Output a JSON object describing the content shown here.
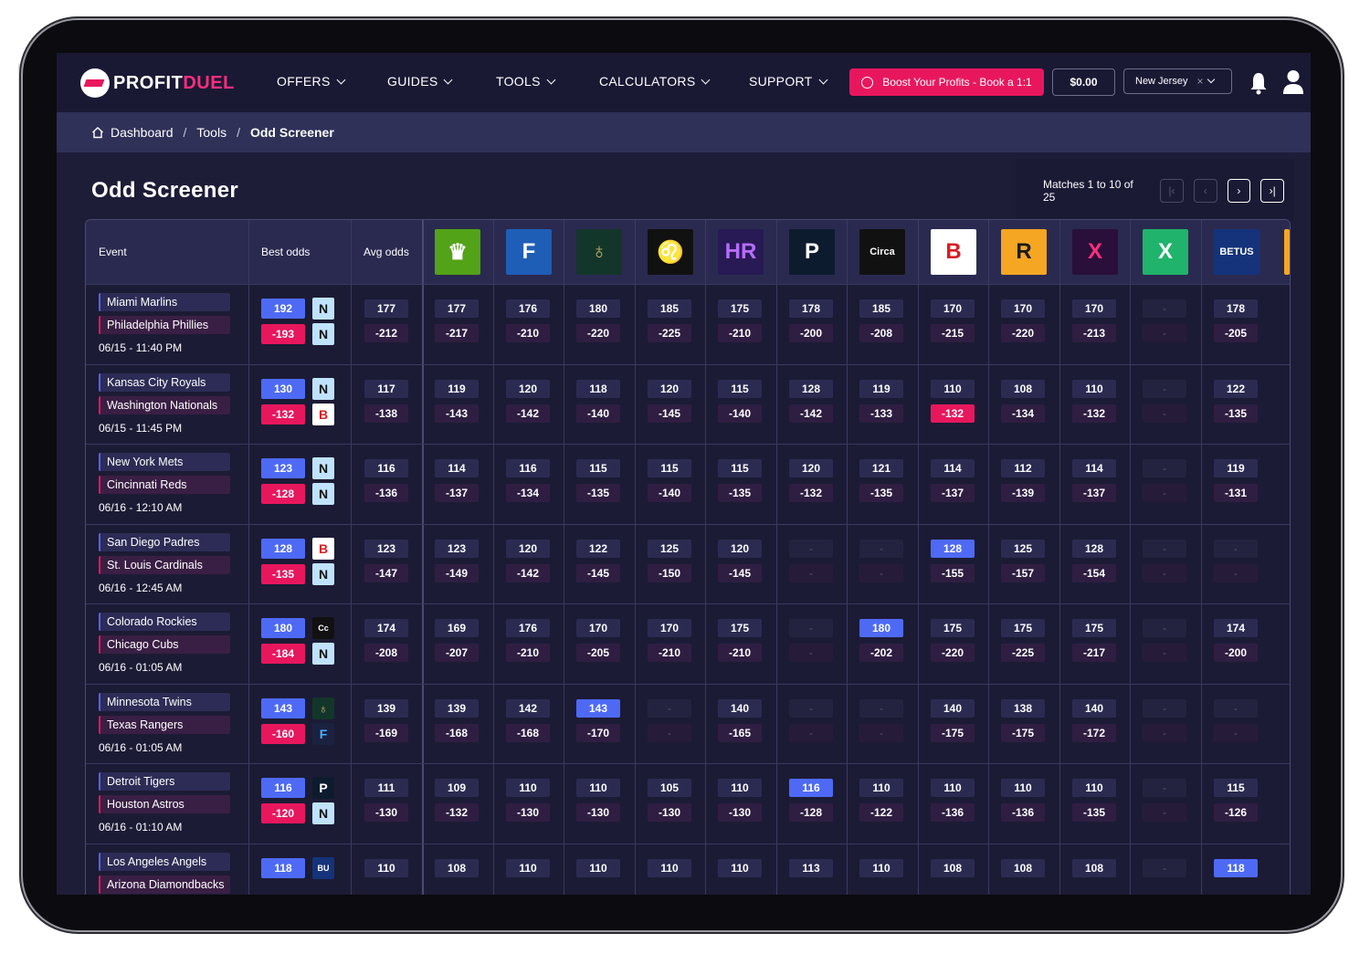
{
  "brand": {
    "part1": "PROFIT",
    "part2": "DUEL"
  },
  "nav": [
    {
      "label": "OFFERS",
      "name": "nav-offers"
    },
    {
      "label": "GUIDES",
      "name": "nav-guides"
    },
    {
      "label": "TOOLS",
      "name": "nav-tools"
    },
    {
      "label": "CALCULATORS",
      "name": "nav-calculators"
    },
    {
      "label": "SUPPORT",
      "name": "nav-support"
    }
  ],
  "header": {
    "boost_label": "Boost Your Profits - Book a 1:1",
    "balance": "$0.00",
    "state": "New Jersey",
    "state_clear": "×"
  },
  "breadcrumb": {
    "items": [
      "Dashboard",
      "Tools"
    ],
    "separator": "/",
    "current": "Odd Screener"
  },
  "page": {
    "title": "Odd Screener"
  },
  "pagination": {
    "text": "Matches 1 to 10 of 25",
    "first": "|‹",
    "prev": "‹",
    "next": "›",
    "last": "›|"
  },
  "table": {
    "col_event": "Event",
    "col_best": "Best odds",
    "col_avg": "Avg odds"
  },
  "books": [
    {
      "id": "draftkings",
      "bg": "#53a318",
      "glyph": "♛",
      "color": "#ffffff"
    },
    {
      "id": "fanduel",
      "bg": "#1f5eb7",
      "glyph": "F",
      "color": "#ffffff"
    },
    {
      "id": "goldennugget",
      "bg": "#13362a",
      "glyph": "♁",
      "color": "#c9b36a"
    },
    {
      "id": "betmgm",
      "bg": "#111111",
      "glyph": "♌",
      "color": "#c8a253"
    },
    {
      "id": "hardrock",
      "bg": "#281a55",
      "glyph": "HR",
      "color": "#b86bff"
    },
    {
      "id": "pointsbet",
      "bg": "#0d1b2e",
      "glyph": "P",
      "color": "#ffffff"
    },
    {
      "id": "circa",
      "bg": "#111111",
      "glyph": "Circa",
      "color": "#ffffff"
    },
    {
      "id": "bally",
      "bg": "#ffffff",
      "glyph": "B",
      "color": "#d61f26"
    },
    {
      "id": "rivers",
      "bg": "#f5a623",
      "glyph": "R",
      "color": "#1a1a1a"
    },
    {
      "id": "betrivers-x",
      "bg": "#2a0f3a",
      "glyph": "X",
      "color": "#ff2e7e"
    },
    {
      "id": "sportsbookx",
      "bg": "#20b36b",
      "glyph": "X",
      "color": "#ffffff"
    },
    {
      "id": "betus",
      "bg": "#14337a",
      "glyph": "BETUS",
      "color": "#ffffff"
    }
  ],
  "mini_books": {
    "N": {
      "bg": "#bfe3ff",
      "glyph": "N",
      "color": "#111"
    },
    "B": {
      "bg": "#ffffff",
      "glyph": "B",
      "color": "#d61f26"
    },
    "CIRCA": {
      "bg": "#111111",
      "glyph": "Cc",
      "color": "#ffffff"
    },
    "GN": {
      "bg": "#13362a",
      "glyph": "♁",
      "color": "#c9b36a"
    },
    "FD": {
      "bg": "#1a2240",
      "glyph": "F",
      "color": "#4ab1ff"
    },
    "PB": {
      "bg": "#0d1b2e",
      "glyph": "P",
      "color": "#ffffff"
    },
    "BETUS": {
      "bg": "#14337a",
      "glyph": "BU",
      "color": "#ffffff"
    }
  },
  "events": [
    {
      "home": "Miami Marlins",
      "away": "Philadelphia Phillies",
      "time": "06/15 - 11:40 PM",
      "best": [
        "192",
        "-193"
      ],
      "best_books": [
        "N",
        "N"
      ],
      "avg": [
        "177",
        "-212"
      ],
      "odds": [
        [
          "177",
          "-217"
        ],
        [
          "176",
          "-210"
        ],
        [
          "180",
          "-220"
        ],
        [
          "185",
          "-225"
        ],
        [
          "175",
          "-210"
        ],
        [
          "178",
          "-200"
        ],
        [
          "185",
          "-208"
        ],
        [
          "170",
          "-215"
        ],
        [
          "170",
          "-220"
        ],
        [
          "170",
          "-213"
        ],
        [
          "-",
          "-"
        ],
        [
          "178",
          "-205"
        ]
      ]
    },
    {
      "home": "Kansas City Royals",
      "away": "Washington Nationals",
      "time": "06/15 - 11:45 PM",
      "best": [
        "130",
        "-132"
      ],
      "best_books": [
        "N",
        "B"
      ],
      "avg": [
        "117",
        "-138"
      ],
      "odds": [
        [
          "119",
          "-143"
        ],
        [
          "120",
          "-142"
        ],
        [
          "118",
          "-140"
        ],
        [
          "120",
          "-145"
        ],
        [
          "115",
          "-140"
        ],
        [
          "128",
          "-142"
        ],
        [
          "119",
          "-133"
        ],
        [
          "110",
          "-132"
        ],
        [
          "108",
          "-134"
        ],
        [
          "110",
          "-132"
        ],
        [
          "-",
          "-"
        ],
        [
          "122",
          "-135"
        ]
      ],
      "hl": [
        [
          7,
          1
        ]
      ]
    },
    {
      "home": "New York Mets",
      "away": "Cincinnati Reds",
      "time": "06/16 - 12:10 AM",
      "best": [
        "123",
        "-128"
      ],
      "best_books": [
        "N",
        "N"
      ],
      "avg": [
        "116",
        "-136"
      ],
      "odds": [
        [
          "114",
          "-137"
        ],
        [
          "116",
          "-134"
        ],
        [
          "115",
          "-135"
        ],
        [
          "115",
          "-140"
        ],
        [
          "115",
          "-135"
        ],
        [
          "120",
          "-132"
        ],
        [
          "121",
          "-135"
        ],
        [
          "114",
          "-137"
        ],
        [
          "112",
          "-139"
        ],
        [
          "114",
          "-137"
        ],
        [
          "-",
          "-"
        ],
        [
          "119",
          "-131"
        ]
      ]
    },
    {
      "home": "San Diego Padres",
      "away": "St. Louis Cardinals",
      "time": "06/16 - 12:45 AM",
      "best": [
        "128",
        "-135"
      ],
      "best_books": [
        "B",
        "N"
      ],
      "avg": [
        "123",
        "-147"
      ],
      "odds": [
        [
          "123",
          "-149"
        ],
        [
          "120",
          "-142"
        ],
        [
          "122",
          "-145"
        ],
        [
          "125",
          "-150"
        ],
        [
          "120",
          "-145"
        ],
        [
          "-",
          "-"
        ],
        [
          "-",
          "-"
        ],
        [
          "128",
          "-155"
        ],
        [
          "125",
          "-157"
        ],
        [
          "128",
          "-154"
        ],
        [
          "-",
          "-"
        ],
        [
          "-",
          "-"
        ]
      ],
      "hl": [
        [
          7,
          0
        ]
      ]
    },
    {
      "home": "Colorado Rockies",
      "away": "Chicago Cubs",
      "time": "06/16 - 01:05 AM",
      "best": [
        "180",
        "-184"
      ],
      "best_books": [
        "CIRCA",
        "N"
      ],
      "avg": [
        "174",
        "-208"
      ],
      "odds": [
        [
          "169",
          "-207"
        ],
        [
          "176",
          "-210"
        ],
        [
          "170",
          "-205"
        ],
        [
          "170",
          "-210"
        ],
        [
          "175",
          "-210"
        ],
        [
          "-",
          "-"
        ],
        [
          "180",
          "-202"
        ],
        [
          "175",
          "-220"
        ],
        [
          "175",
          "-225"
        ],
        [
          "175",
          "-217"
        ],
        [
          "-",
          "-"
        ],
        [
          "174",
          "-200"
        ]
      ],
      "hl": [
        [
          6,
          0
        ]
      ]
    },
    {
      "home": "Minnesota Twins",
      "away": "Texas Rangers",
      "time": "06/16 - 01:05 AM",
      "best": [
        "143",
        "-160"
      ],
      "best_books": [
        "GN",
        "FD"
      ],
      "avg": [
        "139",
        "-169"
      ],
      "odds": [
        [
          "139",
          "-168"
        ],
        [
          "142",
          "-168"
        ],
        [
          "143",
          "-170"
        ],
        [
          "-",
          "-"
        ],
        [
          "140",
          "-165"
        ],
        [
          "-",
          "-"
        ],
        [
          "-",
          "-"
        ],
        [
          "140",
          "-175"
        ],
        [
          "138",
          "-175"
        ],
        [
          "140",
          "-172"
        ],
        [
          "-",
          "-"
        ],
        [
          "-",
          "-"
        ]
      ],
      "hl": [
        [
          2,
          0
        ]
      ]
    },
    {
      "home": "Detroit Tigers",
      "away": "Houston Astros",
      "time": "06/16 - 01:10 AM",
      "best": [
        "116",
        "-120"
      ],
      "best_books": [
        "PB",
        "N"
      ],
      "avg": [
        "111",
        "-130"
      ],
      "odds": [
        [
          "109",
          "-132"
        ],
        [
          "110",
          "-130"
        ],
        [
          "110",
          "-130"
        ],
        [
          "105",
          "-130"
        ],
        [
          "110",
          "-130"
        ],
        [
          "116",
          "-128"
        ],
        [
          "110",
          "-122"
        ],
        [
          "110",
          "-136"
        ],
        [
          "110",
          "-136"
        ],
        [
          "110",
          "-135"
        ],
        [
          "-",
          "-"
        ],
        [
          "115",
          "-126"
        ]
      ],
      "hl": [
        [
          5,
          0
        ]
      ]
    },
    {
      "home": "Los Angeles Angels",
      "away": "Arizona Diamondbacks",
      "time": "",
      "best": [
        "118",
        ""
      ],
      "best_books": [
        "BETUS",
        ""
      ],
      "avg": [
        "110",
        ""
      ],
      "odds": [
        [
          "108",
          ""
        ],
        [
          "110",
          ""
        ],
        [
          "110",
          ""
        ],
        [
          "110",
          ""
        ],
        [
          "110",
          ""
        ],
        [
          "113",
          ""
        ],
        [
          "110",
          ""
        ],
        [
          "108",
          ""
        ],
        [
          "108",
          ""
        ],
        [
          "108",
          ""
        ],
        [
          "-",
          ""
        ],
        [
          "118",
          ""
        ]
      ],
      "hl": [
        [
          11,
          0
        ]
      ]
    }
  ]
}
